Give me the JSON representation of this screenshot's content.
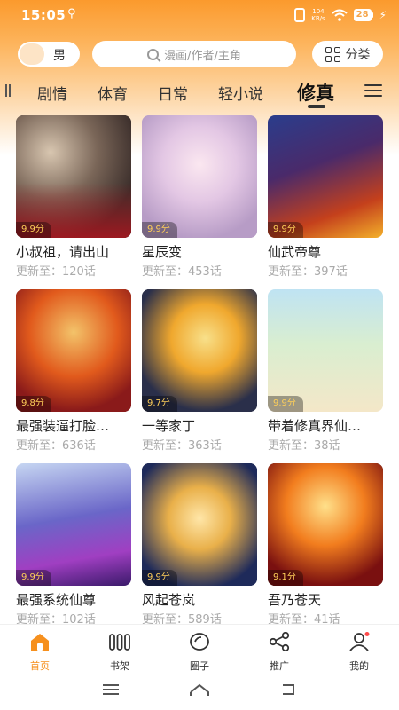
{
  "status_bar": {
    "time": "15:05",
    "usb_glyph": "⚲",
    "net_speed_value": "104",
    "net_speed_unit": "KB/s",
    "battery": "28"
  },
  "header": {
    "gender_label": "男",
    "search_placeholder": "漫画/作者/主角",
    "category_label": "分类"
  },
  "tabs": [
    {
      "label": "剧情"
    },
    {
      "label": "体育"
    },
    {
      "label": "日常"
    },
    {
      "label": "轻小说"
    },
    {
      "label": "修真",
      "active": true
    }
  ],
  "comics": [
    {
      "title": "小叔祖，请出山",
      "update_prefix": "更新至：",
      "update": "120话",
      "rating": "9.9分"
    },
    {
      "title": "星辰变",
      "update_prefix": "更新至：",
      "update": "453话",
      "rating": "9.9分"
    },
    {
      "title": "仙武帝尊",
      "update_prefix": "更新至：",
      "update": "397话",
      "rating": "9.9分"
    },
    {
      "title": "最强装逼打脸…",
      "update_prefix": "更新至：",
      "update": "636话",
      "rating": "9.8分"
    },
    {
      "title": "一等家丁",
      "update_prefix": "更新至：",
      "update": "363话",
      "rating": "9.7分"
    },
    {
      "title": "带着修真界仙…",
      "update_prefix": "更新至：",
      "update": "38话",
      "rating": "9.9分"
    },
    {
      "title": "最强系统仙尊",
      "update_prefix": "更新至：",
      "update": "102话",
      "rating": "9.9分"
    },
    {
      "title": "风起苍岚",
      "update_prefix": "更新至：",
      "update": "589话",
      "rating": "9.9分"
    },
    {
      "title": "吾乃苍天",
      "update_prefix": "更新至：",
      "update": "41话",
      "rating": "9.1分"
    }
  ],
  "bottom_nav": [
    {
      "label": "首页",
      "icon": "home-icon",
      "active": true
    },
    {
      "label": "书架",
      "icon": "bookshelf-icon"
    },
    {
      "label": "圈子",
      "icon": "circle-icon"
    },
    {
      "label": "推广",
      "icon": "share-icon"
    },
    {
      "label": "我的",
      "icon": "profile-icon"
    }
  ],
  "colors": {
    "accent": "#f6901e",
    "rating": "#ffcf59",
    "badge": "#ff4a4a"
  }
}
